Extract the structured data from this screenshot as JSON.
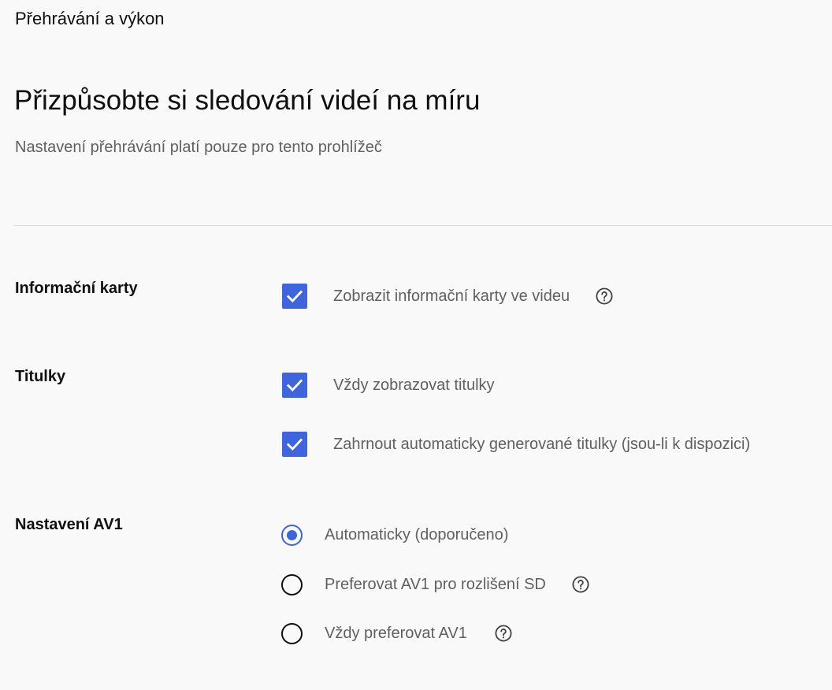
{
  "header": {
    "title": "Přehrávání a výkon"
  },
  "intro": {
    "title": "Přizpůsobte si sledování videí na míru",
    "subtitle": "Nastavení přehrávání platí pouze pro tento prohlížeč"
  },
  "sections": {
    "info_cards": {
      "label": "Informační karty",
      "options": [
        {
          "label": "Zobrazit informační karty ve videu",
          "checked": true,
          "help_icon": "help-circle-icon"
        }
      ]
    },
    "captions": {
      "label": "Titulky",
      "options": [
        {
          "label": "Vždy zobrazovat titulky",
          "checked": true
        },
        {
          "label": "Zahrnout automaticky generované titulky (jsou-li k dispozici)",
          "checked": true
        }
      ]
    },
    "av1": {
      "label": "Nastavení AV1",
      "options": [
        {
          "label": "Automaticky (doporučeno)",
          "selected": true
        },
        {
          "label": "Preferovat AV1 pro rozlišení SD",
          "selected": false,
          "help_icon": "help-circle-icon"
        },
        {
          "label": "Vždy preferovat AV1",
          "selected": false,
          "help_icon": "help-circle-icon"
        }
      ]
    }
  },
  "colors": {
    "accent": "#3e64de",
    "background": "#f9f9f9",
    "primary_text": "#0f0f0f",
    "secondary_text": "#606060",
    "divider": "#d9d9d9"
  }
}
